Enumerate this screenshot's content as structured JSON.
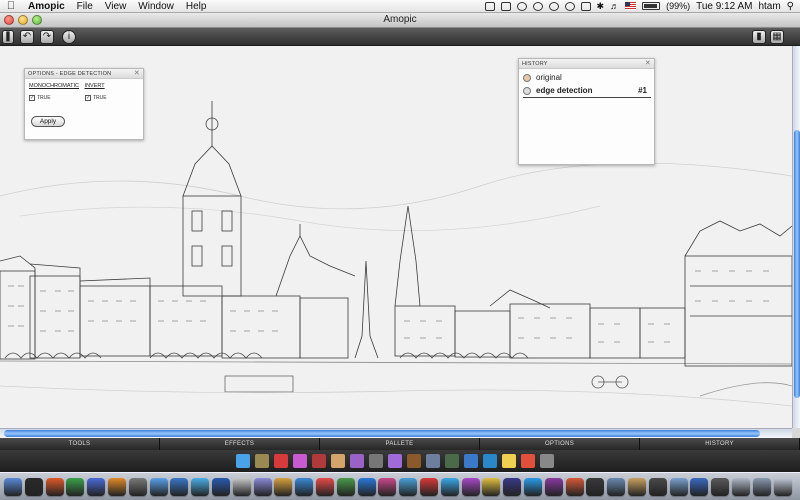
{
  "menubar": {
    "app_name": "Amopic",
    "menus": [
      "File",
      "View",
      "Window",
      "Help"
    ],
    "battery": "(99%)",
    "clock": "Tue 9:12 AM",
    "user": "htam"
  },
  "window": {
    "title": "Amopic"
  },
  "options_panel": {
    "title": "OPTIONS - EDGE DETECTION",
    "monochromatic_label": "MONOCHROMATIC",
    "invert_label": "INVERT",
    "monochromatic_value": "TRUE",
    "invert_value": "TRUE",
    "apply_label": "Apply"
  },
  "history_panel": {
    "title": "HISTORY",
    "items": [
      {
        "label": "original",
        "number": ""
      },
      {
        "label": "edge detection",
        "number": "#1"
      }
    ]
  },
  "panel_tabs": [
    "TOOLS",
    "EFFECTS",
    "PALLETE",
    "OPTIONS",
    "HISTORY"
  ],
  "effects": [
    {
      "name": "water-drop-icon",
      "color": "#4aa3e8"
    },
    {
      "name": "bucket-icon",
      "color": "#9a8a52"
    },
    {
      "name": "record-icon",
      "color": "#d63a3a"
    },
    {
      "name": "flower-icon",
      "color": "#c85ad0"
    },
    {
      "name": "film-icon",
      "color": "#b03a3a"
    },
    {
      "name": "stamp-icon",
      "color": "#d4a46a"
    },
    {
      "name": "puzzle-icon",
      "color": "#9a62c8"
    },
    {
      "name": "wand-icon",
      "color": "#777777"
    },
    {
      "name": "star-icon",
      "color": "#a06ad8"
    },
    {
      "name": "brush-icon",
      "color": "#8a5a2a"
    },
    {
      "name": "frame-icon",
      "color": "#6e7e9e"
    },
    {
      "name": "landscape-icon",
      "color": "#4a6a4a"
    },
    {
      "name": "palette-icon",
      "color": "#3a78c8"
    },
    {
      "name": "globe-icon",
      "color": "#2a88c8"
    },
    {
      "name": "bulb-icon",
      "color": "#f0d050"
    },
    {
      "name": "colors-icon",
      "color": "#e0503a"
    },
    {
      "name": "camera-icon",
      "color": "#888888"
    }
  ],
  "dock": [
    "#5a8ad8",
    "#2a2a2a",
    "#e05a2a",
    "#3aa04a",
    "#4a6ad8",
    "#e08a2a",
    "#7a7a7a",
    "#5aa0e8",
    "#3a78c8",
    "#4ab0e8",
    "#2a5ab0",
    "#c8c8c8",
    "#8a8ad8",
    "#d8a040",
    "#3a8ad8",
    "#e84a4a",
    "#4a9a4a",
    "#2a78d8",
    "#c84a8a",
    "#4aa0d8",
    "#d83a3a",
    "#3aa8e8",
    "#a84ac8",
    "#e0c040",
    "#3a3a8a",
    "#2a9ae8",
    "#8a3aa0",
    "#d85a3a",
    "#3a3a3a",
    "#6a8ab0",
    "#c8a060",
    "#4a4a4a",
    "#7aa0d0",
    "#3a6ac0",
    "#5a5a5a",
    "#b0b8c8",
    "#8a9ab0",
    "#c0c8d8"
  ]
}
